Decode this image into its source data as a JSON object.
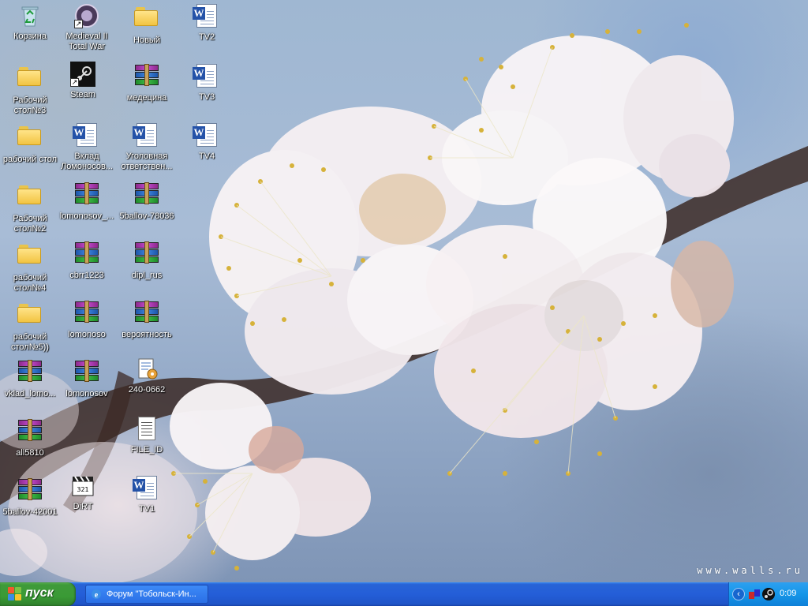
{
  "desktop": {
    "icons": [
      {
        "label": "Корзина",
        "type": "recycle-bin"
      },
      {
        "label": "Medieval II Total War",
        "type": "game-shortcut"
      },
      {
        "label": "Новый",
        "type": "folder"
      },
      {
        "label": "TV2",
        "type": "word-doc"
      },
      {
        "label": "Рабочий стол№3",
        "type": "folder"
      },
      {
        "label": "Steam",
        "type": "steam-shortcut"
      },
      {
        "label": "медецина",
        "type": "rar"
      },
      {
        "label": "TV3",
        "type": "word-doc"
      },
      {
        "label": "рабочий стол",
        "type": "folder"
      },
      {
        "label": "Вклад Ломоносов...",
        "type": "word-doc"
      },
      {
        "label": "Уголовная ответствен...",
        "type": "word-doc"
      },
      {
        "label": "TV4",
        "type": "word-doc"
      },
      {
        "label": "Рабочий стол№2",
        "type": "folder"
      },
      {
        "label": "lomonosov_...",
        "type": "rar"
      },
      {
        "label": "5ballov-78036",
        "type": "rar"
      },
      {
        "label": "рабочий стол№4",
        "type": "folder"
      },
      {
        "label": "cbrr1223",
        "type": "rar"
      },
      {
        "label": "dipl_rus",
        "type": "rar"
      },
      {
        "label": "рабочий стол№5))",
        "type": "folder"
      },
      {
        "label": "lomonoso",
        "type": "rar"
      },
      {
        "label": "вероятность",
        "type": "rar"
      },
      {
        "label": "vklad_lomo...",
        "type": "rar"
      },
      {
        "label": "lomonosov",
        "type": "rar"
      },
      {
        "label": "240-0662",
        "type": "setup-file"
      },
      {
        "label": "all5810",
        "type": "rar"
      },
      {
        "label": "FILE_ID",
        "type": "text-file"
      },
      {
        "label": "5ballov-42001",
        "type": "rar"
      },
      {
        "label": "DiRT",
        "type": "game-shortcut"
      },
      {
        "label": "TV1",
        "type": "word-doc"
      }
    ]
  },
  "wallpaper": {
    "watermark": "www.walls.ru",
    "subject": "apricot-blossom"
  },
  "taskbar": {
    "start_label": "пуск",
    "task_button_label": "Форум \"Тобольск-Ин...",
    "clock": "0:09",
    "colors": {
      "taskbar_blue": "#245ed8",
      "start_green": "#3a9a35",
      "tray_blue": "#1596e8"
    }
  }
}
